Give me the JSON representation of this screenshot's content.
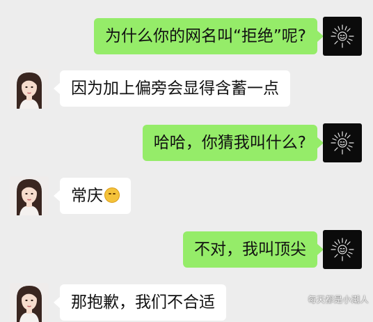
{
  "messages": [
    {
      "side": "me",
      "text": "为什么你的网名叫“拒绝”呢?"
    },
    {
      "side": "her",
      "text": "因为加上偏旁会显得含蓄一点"
    },
    {
      "side": "me",
      "text": "哈哈，你猜我叫什么?"
    },
    {
      "side": "her",
      "text": "常庆",
      "emoji": "thinking-face"
    },
    {
      "side": "me",
      "text": "不对，我叫顶尖"
    },
    {
      "side": "her",
      "text": "那抱歉，我们不合适"
    }
  ],
  "watermark": "每天都是小潮人",
  "colors": {
    "background": "#ededed",
    "my_bubble": "#95ec69",
    "her_bubble": "#ffffff",
    "my_avatar_bg": "#0b0b0b"
  },
  "icons": {
    "my_avatar": "sun-sketch-icon",
    "her_avatar": "girl-portrait-avatar"
  }
}
